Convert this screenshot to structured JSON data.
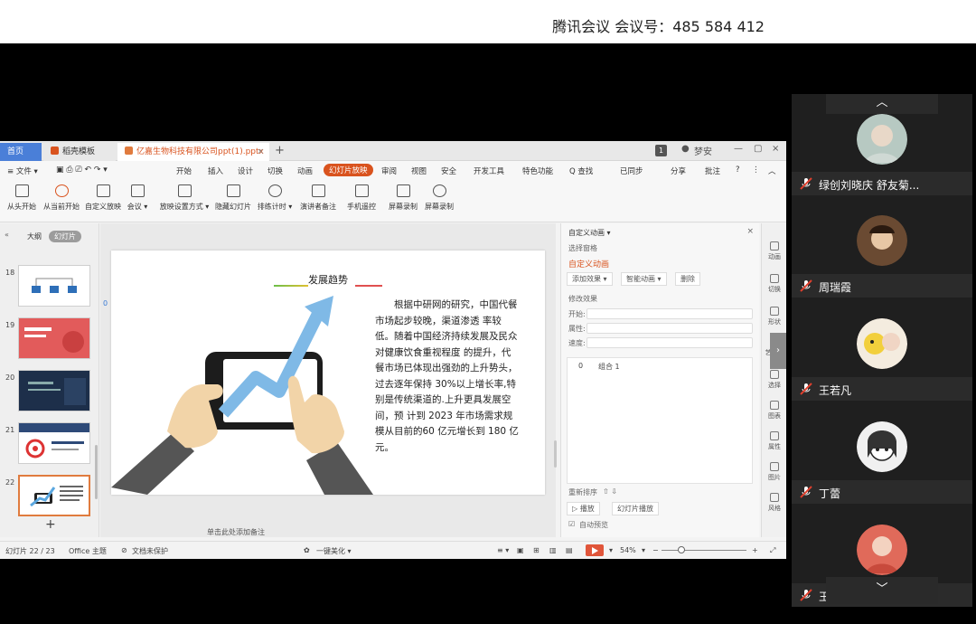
{
  "meeting": {
    "title": "腾讯会议 会议号：485 584 412"
  },
  "wps": {
    "tabs": [
      {
        "label": "首页"
      },
      {
        "label": "稻壳模板"
      },
      {
        "label": "亿嘉生物科技有限公司ppt(1).pptx"
      }
    ],
    "tab_close": "×",
    "tab_add": "+",
    "page_badge": "1",
    "user": "梦安",
    "menu": {
      "file": "≡ 文件 ▾",
      "items": [
        "开始",
        "插入",
        "设计",
        "切换",
        "动画",
        "幻灯片放映",
        "审阅",
        "视图",
        "安全",
        "开发工具",
        "特色功能",
        "Q 查找"
      ],
      "active_item": "幻灯片放映",
      "right_items": [
        "已同步",
        "分享",
        "批注"
      ]
    },
    "toolbar": [
      {
        "label": "从头开始",
        "icon": "screen-icon"
      },
      {
        "label": "从当前开始",
        "icon": "play-icon"
      },
      {
        "label": "自定义放映",
        "icon": "custom-show-icon"
      },
      {
        "label": "会议 ▾",
        "icon": "meeting-icon"
      },
      {
        "label": "放映设置方式 ▾",
        "icon": "settings-icon"
      },
      {
        "label": "隐藏幻灯片",
        "icon": "hide-slide-icon"
      },
      {
        "label": "排练计时 ▾",
        "icon": "timer-icon"
      },
      {
        "label": "演讲者备注",
        "icon": "notes-icon"
      },
      {
        "label": "手机遥控",
        "icon": "phone-icon"
      },
      {
        "label": "屏幕录制",
        "icon": "record-icon"
      },
      {
        "label": "屏幕录制",
        "icon": "record2-icon"
      }
    ],
    "panel": {
      "tab_outline": "大纲",
      "tab_slides": "幻灯片",
      "thumbs": [
        "18",
        "19",
        "20",
        "21",
        "22"
      ],
      "add": "+"
    },
    "slide": {
      "title": "发展趋势",
      "body": "根据中研网的研究，中国代餐市场起步较晚，渠道渗透 率较低。随着中国经济持续发展及民众对健康饮食重视程度 的提升，代餐市场已体现出强劲的上升势头，过去逐年保持 30%以上增长率,特别是传统渠道的.上升更具发展空间，预 计到 2023 年市场需求规模从目前的60 亿元增长到 180 亿元。",
      "note": "单击此处添加备注",
      "marker": "0"
    },
    "anim_pane": {
      "title": "自定义动画 ▾",
      "select_pane": "选择窗格",
      "custom_anim": "自定义动画",
      "add_effect": "添加效果 ▾",
      "smart_anim": "智能动画 ▾",
      "delete": "删除",
      "modify": "修改效果",
      "start": "开始:",
      "property": "属性:",
      "speed": "速度:",
      "item_index": "0",
      "item_name": "组合 1",
      "reorder": "重新排序",
      "play": "▷ 播放",
      "slideshow": "幻灯片播放",
      "autopreview": "自动预览"
    },
    "side_items": [
      "动画",
      "切换",
      "形状",
      "艺术字",
      "选择",
      "图表",
      "属性",
      "图片",
      "风格"
    ],
    "status": {
      "slide_num": "幻灯片 22 / 23",
      "theme": "Office 主题",
      "doc_protect": "文档未保护",
      "beautify": "一键美化 ▾",
      "zoom": "54%"
    }
  },
  "participants": [
    {
      "name": "绿创刘晓庆 舒友菊..."
    },
    {
      "name": "周瑞霞"
    },
    {
      "name": "王若凡"
    },
    {
      "name": "丁蕾"
    },
    {
      "name": "王婉婷"
    }
  ],
  "colors": {
    "accent_orange": "#d9531e",
    "participant_bg": "#1f1f1f",
    "mic_muted": "#e0402e"
  }
}
